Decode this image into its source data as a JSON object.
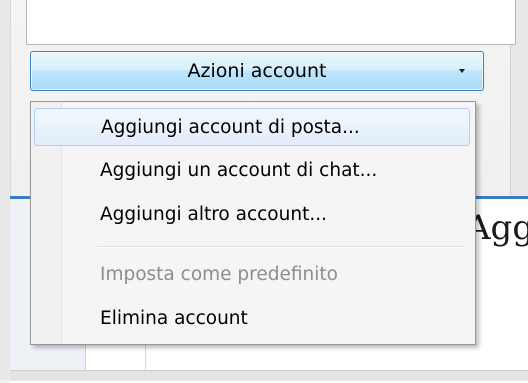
{
  "account_button": {
    "label": "Azioni account"
  },
  "menu": {
    "items": [
      {
        "label": "Aggiungi account di posta...",
        "highlighted": true,
        "disabled": false
      },
      {
        "label": "Aggiungi un account di chat...",
        "highlighted": false,
        "disabled": false
      },
      {
        "label": "Aggiungi altro account...",
        "highlighted": false,
        "disabled": false
      },
      {
        "label": "Imposta come predefinito",
        "highlighted": false,
        "disabled": true
      },
      {
        "label": "Elimina account",
        "highlighted": false,
        "disabled": false
      }
    ]
  },
  "background": {
    "partial_text": "Aggiu"
  },
  "colors": {
    "accent": "#3a7cc1",
    "button_border": "#3c7fb1",
    "highlight_border": "#aecff7"
  }
}
